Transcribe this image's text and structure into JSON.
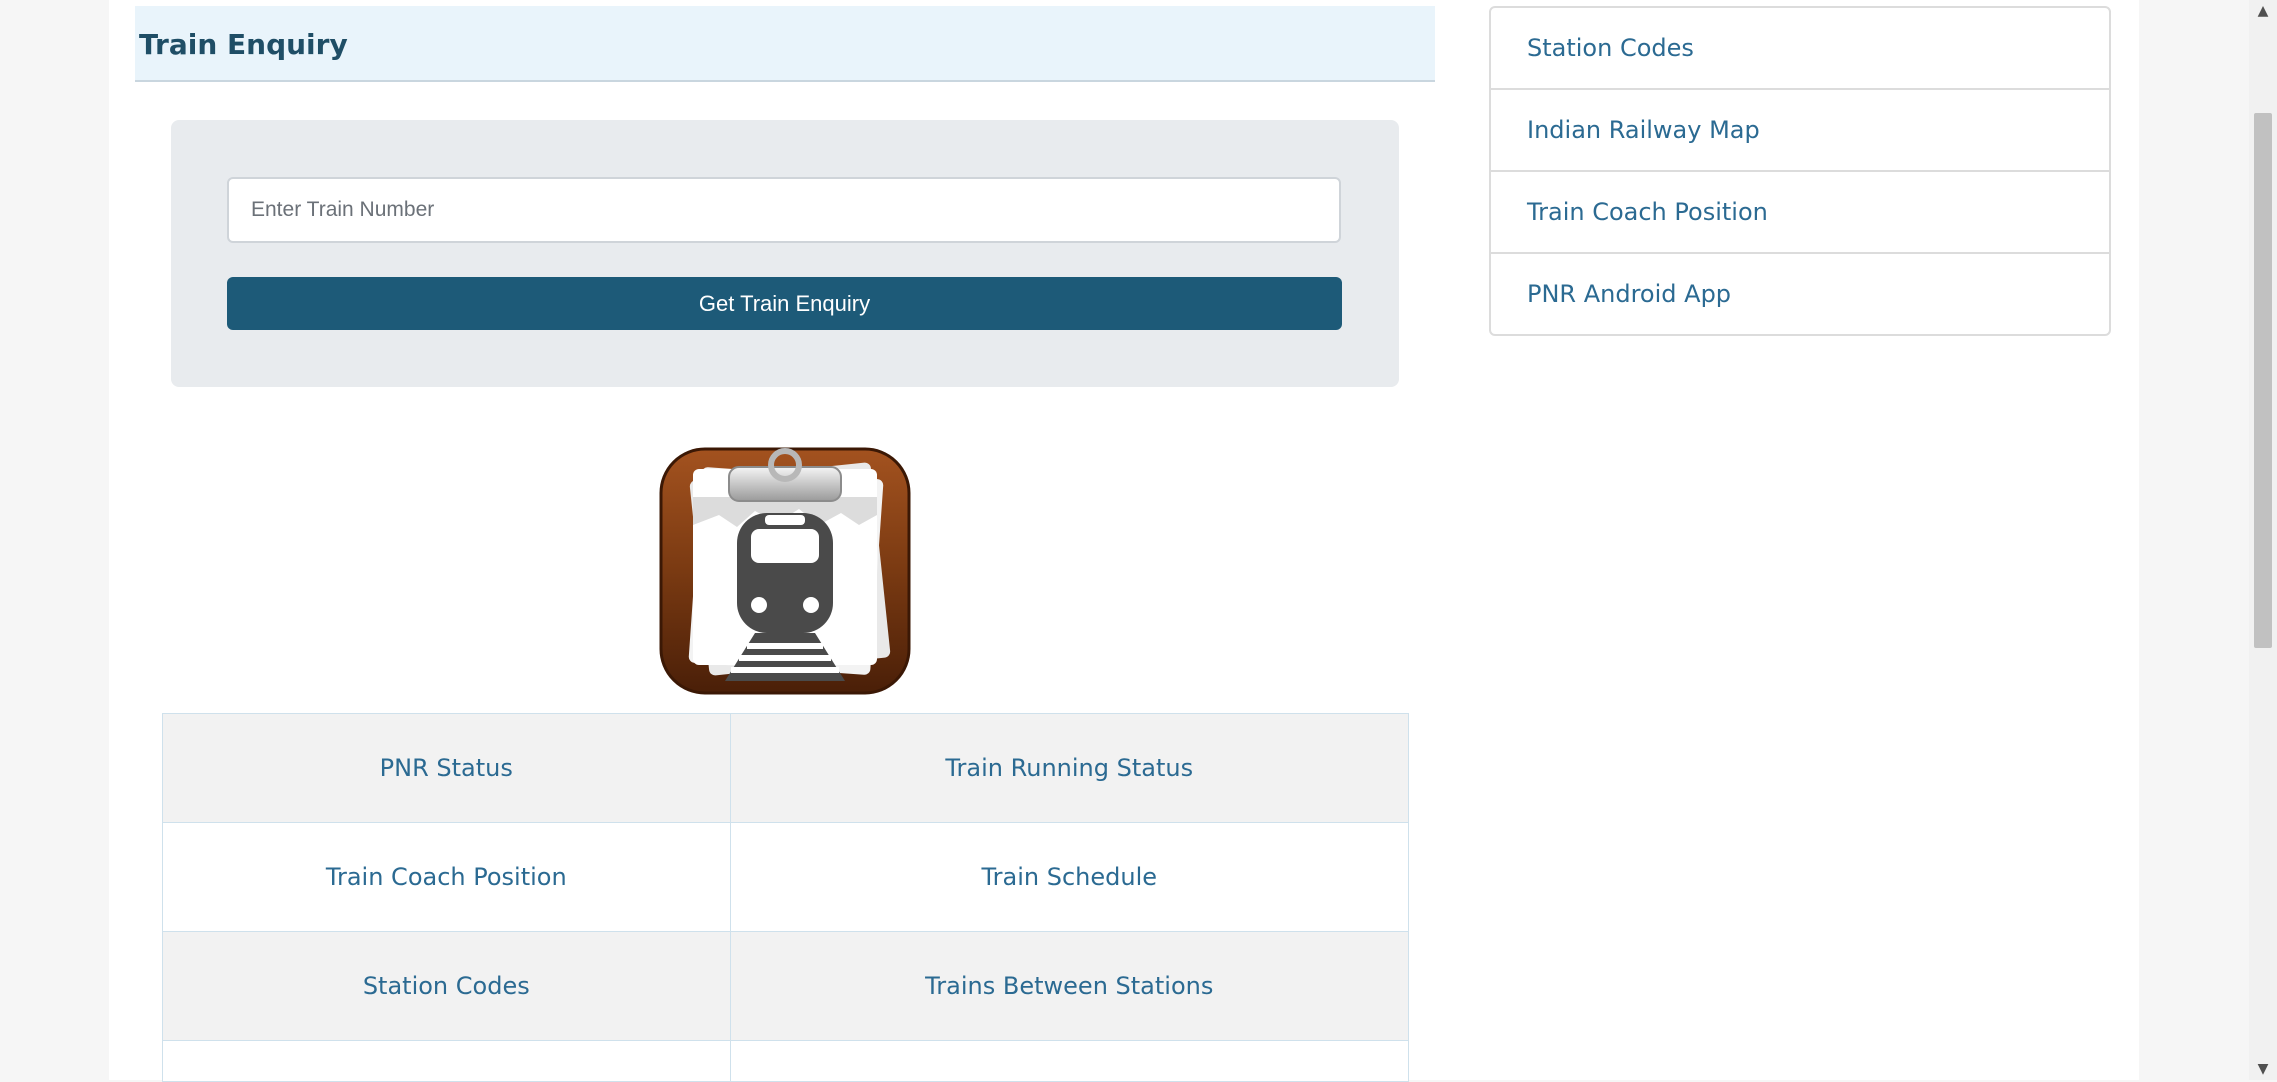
{
  "header": {
    "title": "Train Enquiry"
  },
  "form": {
    "placeholder": "Enter Train Number",
    "value": "",
    "button_label": "Get Train Enquiry"
  },
  "links_table": {
    "rows": [
      [
        "PNR Status",
        "Train Running Status"
      ],
      [
        "Train Coach Position",
        "Train Schedule"
      ],
      [
        "Station Codes",
        "Trains Between Stations"
      ]
    ]
  },
  "sidebar": {
    "items": [
      {
        "label": "Station Codes"
      },
      {
        "label": "Indian Railway Map"
      },
      {
        "label": "Train Coach Position"
      },
      {
        "label": "PNR Android App"
      }
    ]
  },
  "icons": {
    "logo": "train-clipboard-icon",
    "scroll_up": "chevron-up-icon",
    "scroll_down": "chevron-down-icon"
  },
  "colors": {
    "accent": "#1d5a78",
    "link": "#2b6a92",
    "header_bg": "#e9f4fb",
    "title": "#1f4e66"
  }
}
